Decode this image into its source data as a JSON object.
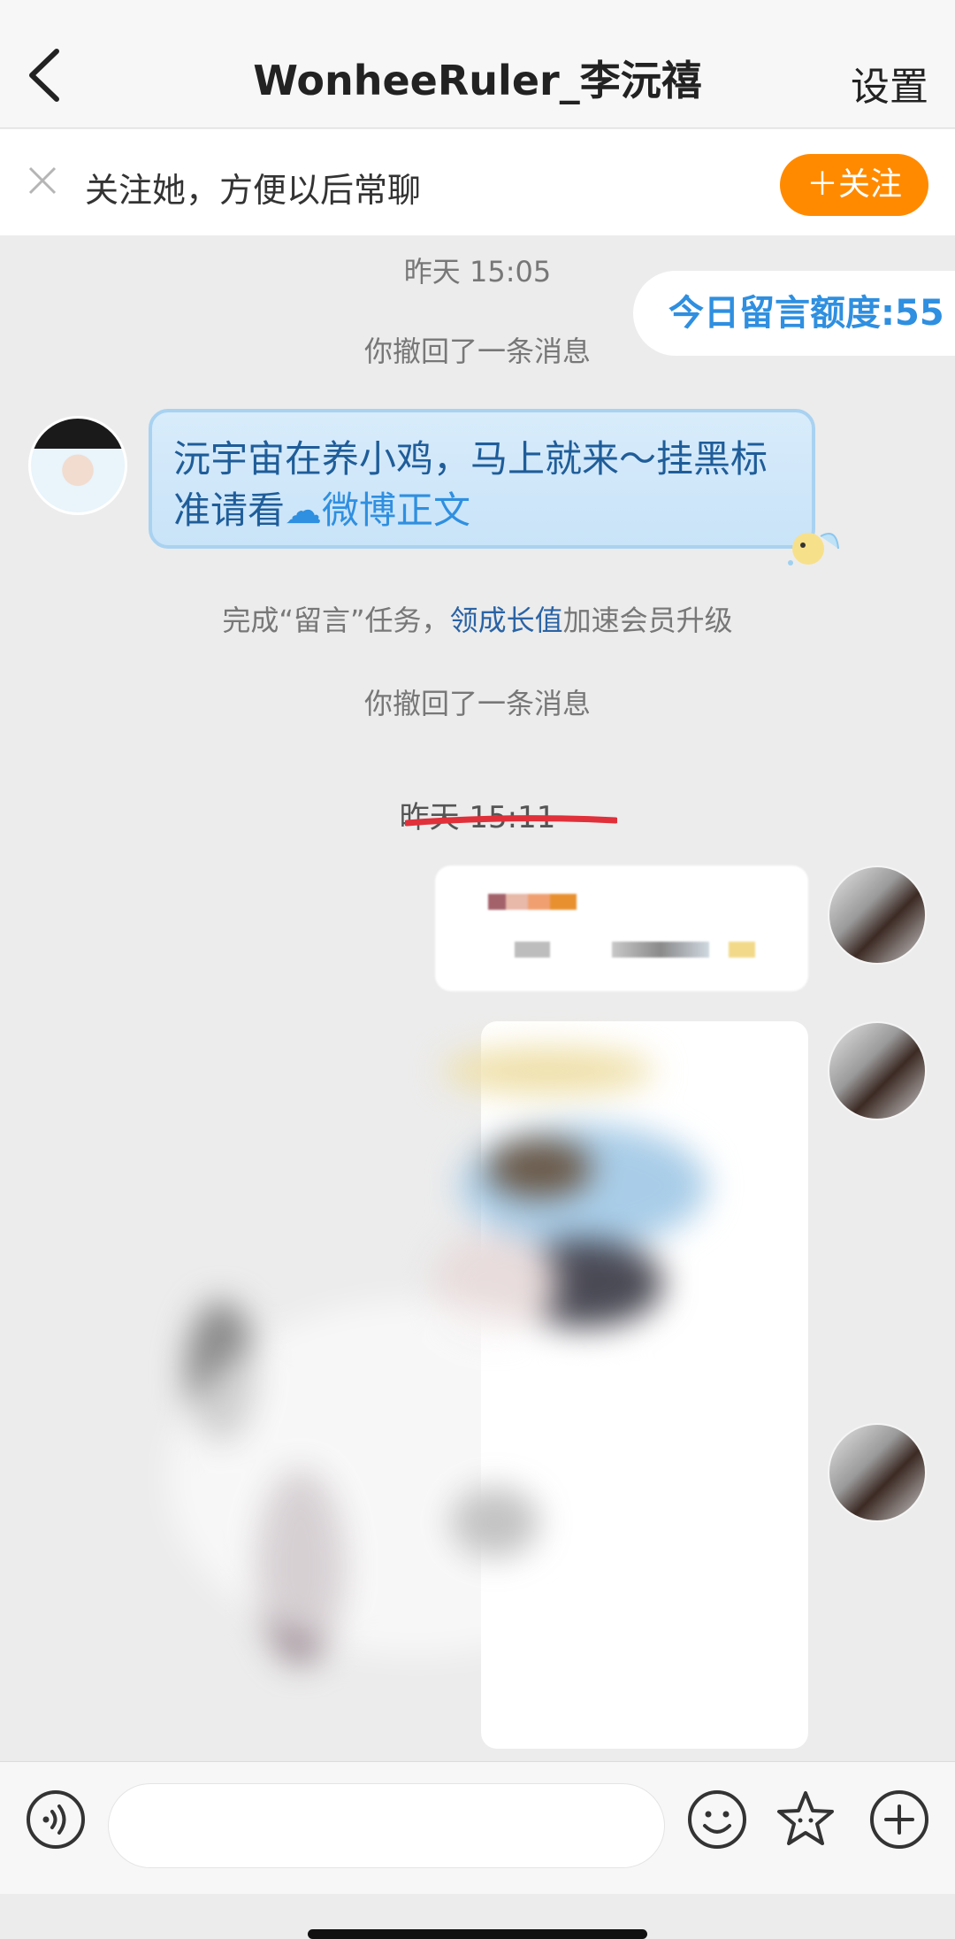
{
  "header": {
    "title": "WonheeRuler_李沅禧",
    "settings_label": "设置"
  },
  "follow_bar": {
    "text": "关注她，方便以后常聊",
    "button_label": "＋关注"
  },
  "quota": {
    "text": "今日留言额度:55"
  },
  "messages": {
    "time_1": "昨天 15:05",
    "recall_1": "你撤回了一条消息",
    "incoming_text_1": "沅宇宙在养小鸡，马上就来～挂黑标准请看",
    "incoming_link": "微博正文",
    "task_prefix": "完成“留言”任务，",
    "task_link": "领成长值",
    "task_suffix": "加速会员升级",
    "recall_2": "你撤回了一条消息",
    "time_2": "昨天 15:11"
  },
  "colors": {
    "accent_orange": "#ff8a00",
    "link_blue": "#2f8fe0",
    "underline_red": "#e0303a",
    "background": "#ececec"
  },
  "icons": {
    "back": "chevron-left-icon",
    "close": "close-icon",
    "voice": "voice-icon",
    "emoji": "emoji-icon",
    "sticker": "star-sticker-icon",
    "add": "plus-icon"
  }
}
